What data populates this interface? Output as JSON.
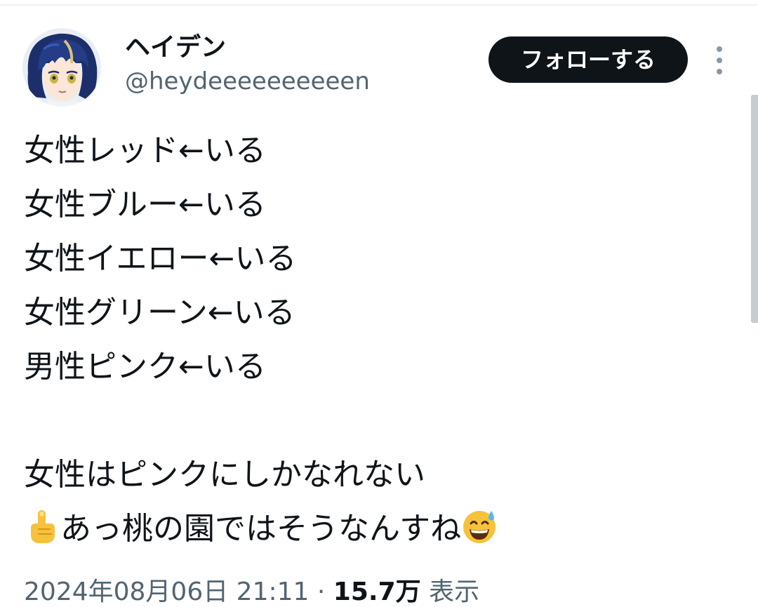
{
  "author": {
    "display_name": "ヘイデン",
    "handle": "@heydeeeeeeeeeen"
  },
  "follow_button": {
    "label": "フォローする"
  },
  "icons": {
    "more": "more-vertical-icon",
    "point_up": "index-pointing-up-icon",
    "sweat_smile": "grinning-face-with-sweat-icon"
  },
  "tweet": {
    "lines": [
      "女性レッド←いる",
      "女性ブルー←いる",
      "女性イエロー←いる",
      "女性グリーン←いる",
      "男性ピンク←いる",
      "",
      "女性はピンクにしかなれない",
      "あっ桃の園ではそうなんすね"
    ]
  },
  "meta": {
    "timestamp": "2024年08月06日 21:11",
    "separator": "·",
    "views_count": "15.7万",
    "views_label": "表示"
  },
  "colors": {
    "follow_bg": "#0f1419",
    "follow_text": "#ffffff",
    "primary_text": "#0f1419",
    "secondary_text": "#536471"
  }
}
